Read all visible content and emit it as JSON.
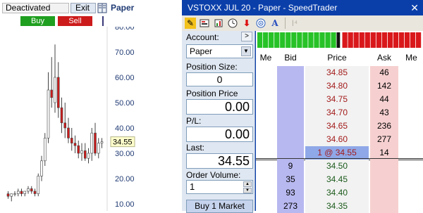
{
  "chart_pane": {
    "status_field": "Deactivated",
    "exit_label": "Exit",
    "account_label": "Paper",
    "buy_label": "Buy",
    "sell_label": "Sell",
    "last_price_tag": "34.55"
  },
  "chart_data": {
    "type": "candlestick",
    "y_ticks": [
      "80.00",
      "70.00",
      "60.00",
      "50.00",
      "40.00",
      "30.00",
      "20.00",
      "10.00"
    ],
    "ylim": [
      10,
      80
    ],
    "candles": [
      [
        14,
        15,
        12,
        13
      ],
      [
        13,
        14,
        11,
        14
      ],
      [
        14,
        15,
        13,
        14
      ],
      [
        14,
        16,
        13,
        15
      ],
      [
        15,
        16,
        13,
        14
      ],
      [
        14,
        15,
        13,
        15
      ],
      [
        15,
        17,
        14,
        16
      ],
      [
        16,
        17,
        14,
        15
      ],
      [
        15,
        16,
        13,
        14
      ],
      [
        14,
        22,
        13,
        21
      ],
      [
        21,
        29,
        19,
        27
      ],
      [
        27,
        38,
        25,
        36
      ],
      [
        36,
        62,
        34,
        55
      ],
      [
        55,
        68,
        48,
        52
      ],
      [
        50,
        73,
        46,
        60
      ],
      [
        60,
        66,
        44,
        48
      ],
      [
        48,
        52,
        38,
        42
      ],
      [
        42,
        50,
        36,
        40
      ],
      [
        40,
        44,
        34,
        36
      ],
      [
        36,
        40,
        31,
        34
      ],
      [
        34,
        37,
        30,
        33
      ],
      [
        33,
        35,
        28,
        30
      ],
      [
        30,
        34,
        27,
        31
      ],
      [
        31,
        34,
        27,
        28
      ],
      [
        28,
        32,
        26,
        30
      ],
      [
        30,
        40,
        27,
        38
      ],
      [
        38,
        42,
        29,
        30
      ],
      [
        30,
        36,
        28,
        34
      ],
      [
        34,
        36,
        32,
        34.55
      ]
    ],
    "colors": {
      "up": "#ffffff",
      "down": "#cc1b1b",
      "wick": "#444444",
      "axis_text": "#1f3a73"
    }
  },
  "window": {
    "title": "VSTOXX JUL 20  - Paper - SpeedTrader",
    "close": "✕"
  },
  "side": {
    "account_label": "Account:",
    "account_value": "Paper",
    "collapse_label": ">",
    "position_size_label": "Position Size:",
    "position_size": "0",
    "position_price_label": "Position Price",
    "position_price": "0.00",
    "pl_label": "P/L:",
    "pl": "0.00",
    "last_label": "Last:",
    "last": "34.55",
    "order_volume_label": "Order Volume:",
    "order_volume": "1",
    "buy_market_label": "Buy 1 Market"
  },
  "ladder": {
    "headers": {
      "me1": "Me",
      "bid": "Bid",
      "price": "Price",
      "ask": "Ask",
      "me2": "Me"
    },
    "rows": [
      {
        "bid": "",
        "price": "34.85",
        "ask": "46"
      },
      {
        "bid": "",
        "price": "34.80",
        "ask": "142"
      },
      {
        "bid": "",
        "price": "34.75",
        "ask": "44"
      },
      {
        "bid": "",
        "price": "34.70",
        "ask": "43"
      },
      {
        "bid": "",
        "price": "34.65",
        "ask": "236"
      },
      {
        "bid": "",
        "price": "34.60",
        "ask": "277"
      },
      {
        "bid": "",
        "price": "1 @ 34.55",
        "ask": "14"
      },
      {
        "bid": "9",
        "price": "34.50",
        "ask": ""
      },
      {
        "bid": "35",
        "price": "34.45",
        "ask": ""
      },
      {
        "bid": "93",
        "price": "34.40",
        "ask": ""
      },
      {
        "bid": "273",
        "price": "34.35",
        "ask": ""
      }
    ],
    "heat_bar": [
      "green",
      "green",
      "green",
      "green",
      "green",
      "green",
      "green",
      "green",
      "green",
      "green",
      "green",
      "green",
      "green",
      "green",
      "black",
      "red",
      "red",
      "red",
      "red",
      "red",
      "red",
      "red",
      "red",
      "red",
      "red",
      "red",
      "red",
      "red",
      "red"
    ]
  }
}
